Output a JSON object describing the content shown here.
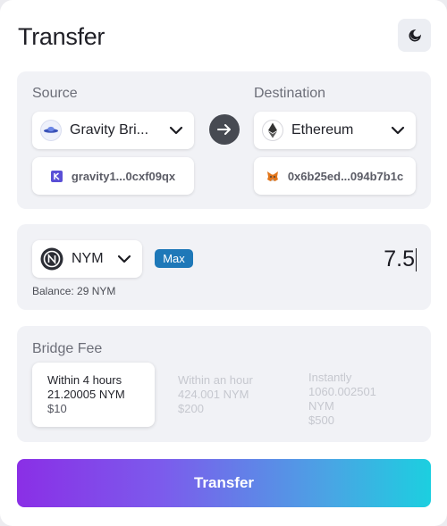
{
  "header": {
    "title": "Transfer",
    "theme_icon": "moon-icon"
  },
  "route": {
    "source_label": "Source",
    "destination_label": "Destination",
    "source_chain": "Gravity Bri...",
    "destination_chain": "Ethereum",
    "source_address": "gravity1...0cxf09qx",
    "destination_address": "0x6b25ed...094b7b1c",
    "swap_icon": "arrow-right-icon"
  },
  "asset": {
    "token": "NYM",
    "max_label": "Max",
    "amount": "7.5",
    "balance_label": "Balance:",
    "balance_value": "29 NYM"
  },
  "bridge_fee": {
    "label": "Bridge Fee",
    "options": [
      {
        "time": "Within 4 hours",
        "amount": "21.20005 NYM",
        "price": "$10",
        "selected": true
      },
      {
        "time": "Within an hour",
        "amount": "424.001 NYM",
        "price": "$200",
        "selected": false
      },
      {
        "time": "Instantly",
        "amount_line1": "1060.002501",
        "amount_line2": "NYM",
        "price": "$500",
        "selected": false
      }
    ]
  },
  "footer": {
    "transfer_label": "Transfer"
  },
  "colors": {
    "accent_start": "#8a2fe6",
    "accent_end": "#1ccfe0",
    "max_badge": "#1e78b8",
    "panel": "#f1f2f6"
  }
}
